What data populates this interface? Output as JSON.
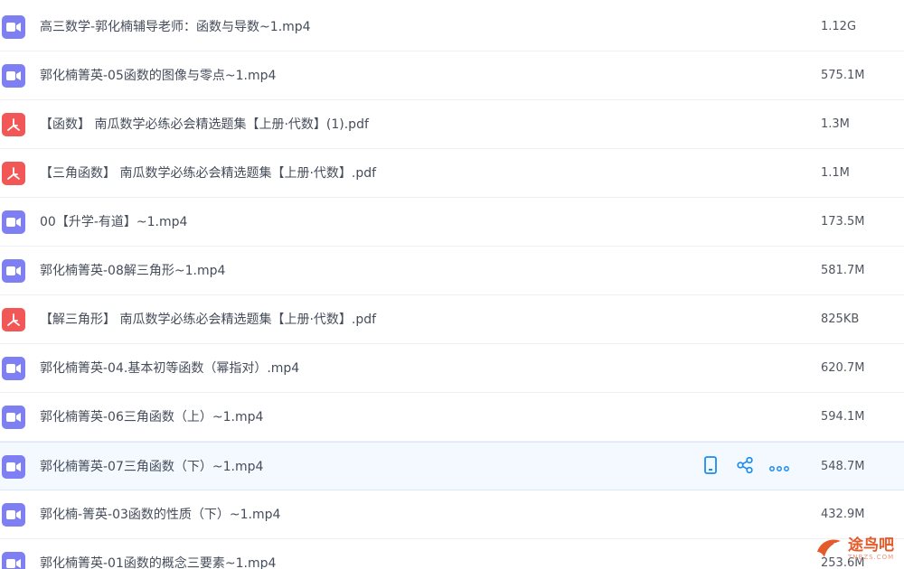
{
  "files": [
    {
      "type": "video",
      "name": "高三数学-郭化楠辅导老师：函数与导数~1.mp4",
      "size": "1.12G"
    },
    {
      "type": "video",
      "name": "郭化楠箐英-05函数的图像与零点~1.mp4",
      "size": "575.1M"
    },
    {
      "type": "pdf",
      "name": "【函数】 南瓜数学必练必会精选题集【上册·代数】(1).pdf",
      "size": "1.3M"
    },
    {
      "type": "pdf",
      "name": "【三角函数】 南瓜数学必练必会精选题集【上册·代数】.pdf",
      "size": "1.1M"
    },
    {
      "type": "video",
      "name": "00【升学-有道】~1.mp4",
      "size": "173.5M"
    },
    {
      "type": "video",
      "name": "郭化楠箐英-08解三角形~1.mp4",
      "size": "581.7M"
    },
    {
      "type": "pdf",
      "name": "【解三角形】 南瓜数学必练必会精选题集【上册·代数】.pdf",
      "size": "825KB"
    },
    {
      "type": "video",
      "name": "郭化楠箐英-04.基本初等函数（幂指对）.mp4",
      "size": "620.7M"
    },
    {
      "type": "video",
      "name": "郭化楠箐英-06三角函数（上）~1.mp4",
      "size": "594.1M"
    },
    {
      "type": "video",
      "name": "郭化楠箐英-07三角函数（下）~1.mp4",
      "size": "548.7M"
    },
    {
      "type": "video",
      "name": "郭化楠-箐英-03函数的性质（下）~1.mp4",
      "size": "432.9M"
    },
    {
      "type": "video",
      "name": "郭化楠箐英-01函数的概念三要素~1.mp4",
      "size": "253.6M"
    }
  ],
  "hover_row_index": 9,
  "row_actions": [
    {
      "icon": "phone-icon",
      "label": ""
    },
    {
      "icon": "share-icon",
      "label": ""
    },
    {
      "icon": "more-icon",
      "label": ""
    }
  ],
  "colors": {
    "video_icon": "#7f7ff4",
    "pdf_icon": "#f25757",
    "action_icon": "#1b8cf0",
    "hover_row": "#f4f9ff"
  },
  "watermark": {
    "text": "途鸟吧",
    "sub": "TNBZS.COM"
  }
}
